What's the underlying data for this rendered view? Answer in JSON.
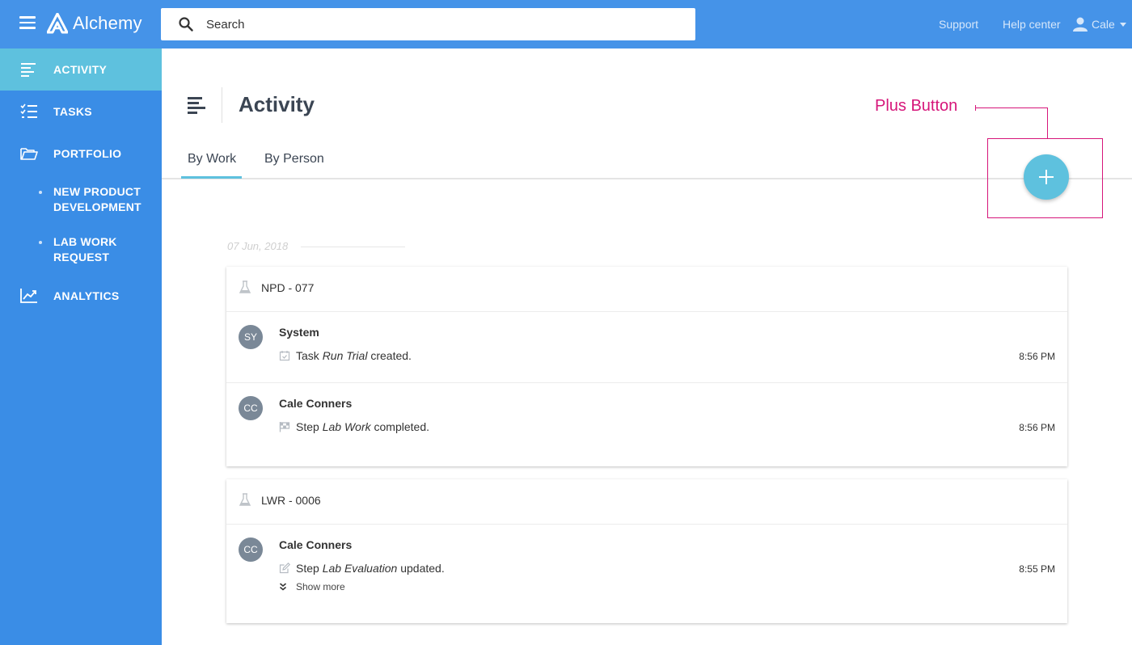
{
  "app": {
    "name": "Alchemy"
  },
  "search": {
    "placeholder": "Search"
  },
  "header_links": {
    "support": "Support",
    "help": "Help center",
    "user": "Cale"
  },
  "sidebar": {
    "items": [
      {
        "label": "ACTIVITY",
        "icon": "activity-icon",
        "active": true
      },
      {
        "label": "TASKS",
        "icon": "tasks-icon"
      },
      {
        "label": "PORTFOLIO",
        "icon": "folder-icon"
      },
      {
        "label": "ANALYTICS",
        "icon": "analytics-icon"
      }
    ],
    "sub_items": [
      {
        "label": "NEW PRODUCT DEVELOPMENT"
      },
      {
        "label": "LAB WORK REQUEST"
      }
    ]
  },
  "page": {
    "title": "Activity"
  },
  "tabs": [
    {
      "label": "By Work",
      "active": true
    },
    {
      "label": "By Person"
    }
  ],
  "annotation": {
    "label": "Plus Button",
    "color": "#d6167a"
  },
  "date_group": "07 Jun, 2018",
  "cards": [
    {
      "ref": "NPD - 077",
      "entries": [
        {
          "initials": "SY",
          "name": "System",
          "verb": "Task",
          "object": "Run Trial",
          "action": "created.",
          "time": "8:56 PM",
          "icon": "task-check-icon"
        },
        {
          "initials": "CC",
          "name": "Cale Conners",
          "verb": "Step",
          "object": "Lab Work",
          "action": "completed.",
          "time": "8:56 PM",
          "icon": "flag-icon"
        }
      ]
    },
    {
      "ref": "LWR - 0006",
      "entries": [
        {
          "initials": "CC",
          "name": "Cale Conners",
          "verb": "Step",
          "object": "Lab Evaluation",
          "action": "updated.",
          "time": "8:55 PM",
          "icon": "edit-icon",
          "show_more": "Show more"
        }
      ]
    }
  ],
  "colors": {
    "topbar": "#4593e8",
    "sidebar": "#3a8de6",
    "accent": "#5ec1de",
    "avatar": "#7a8897"
  }
}
